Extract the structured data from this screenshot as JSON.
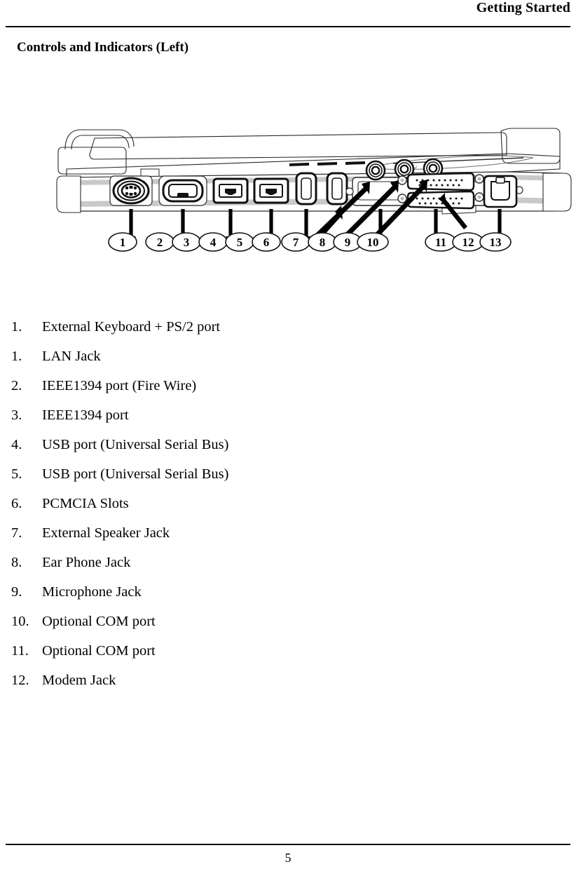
{
  "header": {
    "title": "Getting Started",
    "rule": true
  },
  "section": {
    "heading": "Controls and Indicators (Left)"
  },
  "figure": {
    "name": "notebook-left-side-view",
    "description": "Line drawing of the left side of a notebook computer with 13 numbered callouts",
    "callouts": [
      {
        "number": "1",
        "target": "ps2-port"
      },
      {
        "number": "2",
        "target": "lan-jack"
      },
      {
        "number": "3",
        "target": "ieee1394-port-firewire"
      },
      {
        "number": "4",
        "target": "ieee1394-port"
      },
      {
        "number": "5",
        "target": "usb-port-1"
      },
      {
        "number": "6",
        "target": "usb-port-2"
      },
      {
        "number": "7",
        "target": "pcmcia-slots"
      },
      {
        "number": "8",
        "target": "external-speaker-jack"
      },
      {
        "number": "9",
        "target": "ear-phone-jack"
      },
      {
        "number": "10",
        "target": "microphone-jack"
      },
      {
        "number": "11",
        "target": "optional-com-port-1"
      },
      {
        "number": "12",
        "target": "optional-com-port-2"
      },
      {
        "number": "13",
        "target": "modem-jack"
      }
    ]
  },
  "list": {
    "items": [
      {
        "num": "1.",
        "label": "External Keyboard + PS/2 port"
      },
      {
        "num": "1.",
        "label": "LAN Jack"
      },
      {
        "num": "2.",
        "label": "IEEE1394 port (Fire Wire)"
      },
      {
        "num": "3.",
        "label": "IEEE1394 port"
      },
      {
        "num": "4.",
        "label": "USB port (Universal Serial Bus)"
      },
      {
        "num": "5.",
        "label": "USB port (Universal Serial Bus)"
      },
      {
        "num": "6.",
        "label": "PCMCIA Slots"
      },
      {
        "num": "7.",
        "label": "External Speaker Jack"
      },
      {
        "num": "8.",
        "label": "Ear Phone Jack"
      },
      {
        "num": "9.",
        "label": "Microphone Jack"
      },
      {
        "num": "10.",
        "label": "Optional COM port"
      },
      {
        "num": "11.",
        "label": "Optional COM port"
      },
      {
        "num": "12.",
        "label": "Modem Jack"
      }
    ]
  },
  "footer": {
    "page_number": "5",
    "rule": true
  },
  "colors": {
    "text": "#000000",
    "page_background": "#ffffff",
    "line_art": "#1a1a1a",
    "shading": "#b5b5b5"
  }
}
